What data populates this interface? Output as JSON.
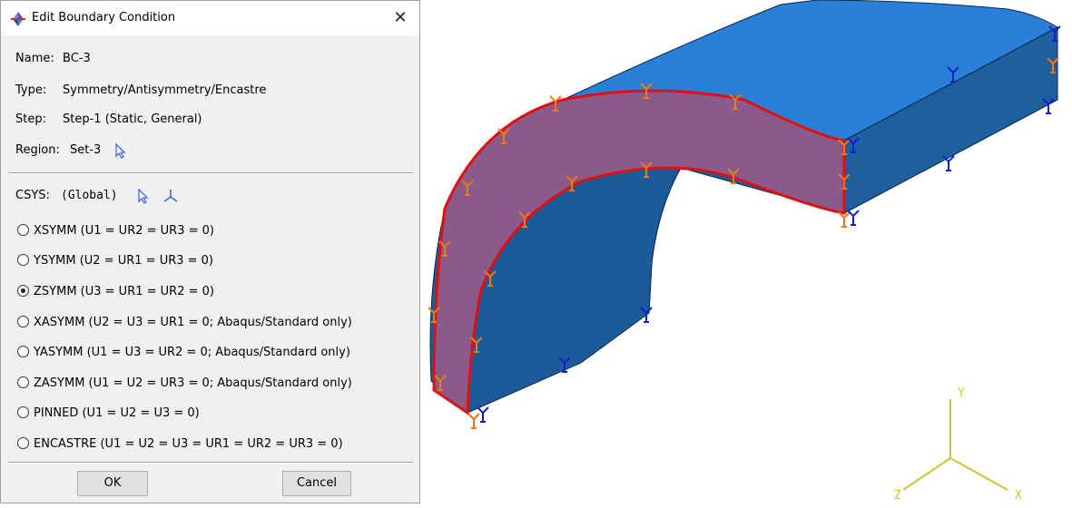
{
  "dialog": {
    "title": "Edit Boundary Condition",
    "close_glyph": "✕",
    "name_label": "Name:",
    "name_value": "BC-3",
    "type_label": "Type:",
    "type_value": "Symmetry/Antisymmetry/Encastre",
    "step_label": "Step:",
    "step_value": "Step-1 (Static, General)",
    "region_label": "Region:",
    "region_value": "Set-3",
    "csys_label": "CSYS:",
    "csys_value": "(Global)",
    "options": [
      {
        "label": "XSYMM (U1 = UR2 = UR3 = 0)",
        "selected": false
      },
      {
        "label": "YSYMM (U2 = UR1 = UR3 = 0)",
        "selected": false
      },
      {
        "label": "ZSYMM (U3 = UR1 = UR2 = 0)",
        "selected": true
      },
      {
        "label": "XASYMM (U2 = U3 = UR1 = 0; Abaqus/Standard only)",
        "selected": false
      },
      {
        "label": "YASYMM (U1 = U3 = UR2 = 0; Abaqus/Standard only)",
        "selected": false
      },
      {
        "label": "ZASYMM (U1 = U2 = UR3 = 0; Abaqus/Standard only)",
        "selected": false
      },
      {
        "label": "PINNED (U1 = U2 = U3 = 0)",
        "selected": false
      },
      {
        "label": "ENCASTRE (U1 = U2 = U3 = UR1 = UR2 = UR3 = 0)",
        "selected": false
      }
    ],
    "ok_label": "OK",
    "cancel_label": "Cancel"
  },
  "triad": {
    "x_label": "X",
    "y_label": "Y",
    "z_label": "Z"
  },
  "colors": {
    "part_top": "#2a7fd8",
    "part_side": "#1d5a9a",
    "selected_face": "#8a5a8a",
    "edge_highlight": "#e01010",
    "bc_orange": "#f07810",
    "bc_blue": "#1020d0",
    "triad": "#c8c830"
  }
}
